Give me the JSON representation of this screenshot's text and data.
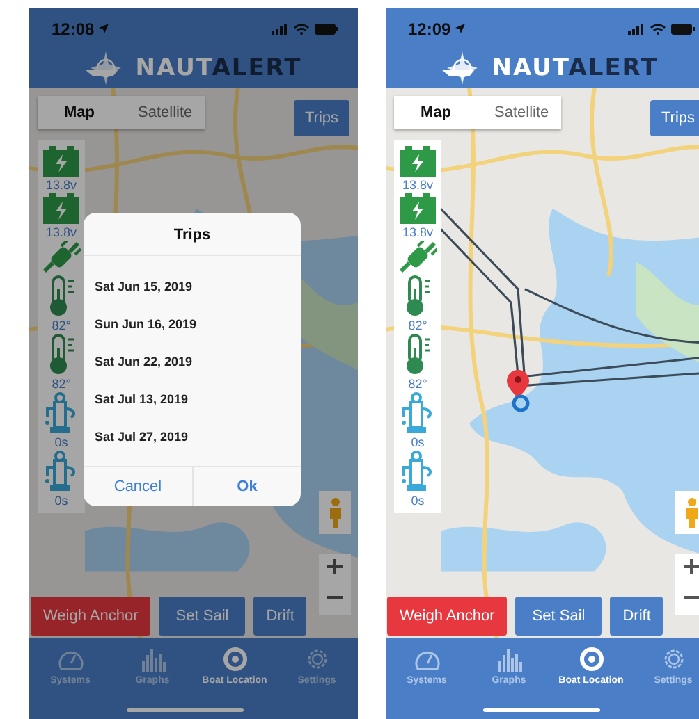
{
  "screens": [
    {
      "status_bar": {
        "time": "12:08"
      },
      "logo": {
        "prefix": "NAUT",
        "suffix": "ALERT"
      },
      "map": {
        "route": false
      },
      "map_types": [
        {
          "label": "Map",
          "selected": true
        },
        {
          "label": "Satellite",
          "selected": false
        }
      ],
      "trips_button": "Trips",
      "sensors": [
        {
          "kind": "battery",
          "reading": "13.8v"
        },
        {
          "kind": "battery",
          "reading": "13.8v"
        },
        {
          "kind": "plug"
        },
        {
          "kind": "thermometer",
          "reading": "82°"
        },
        {
          "kind": "thermometer",
          "reading": "82°"
        },
        {
          "kind": "pump",
          "reading": "0s"
        },
        {
          "kind": "pump",
          "reading": "0s"
        }
      ],
      "dialog": {
        "title": "Trips",
        "items": [
          "Sat Jun 15, 2019",
          "Sun Jun 16, 2019",
          "Sat Jun 22, 2019",
          "Sat Jul 13, 2019",
          "Sat Jul 27, 2019"
        ],
        "buttons": [
          "Cancel",
          "Ok"
        ]
      },
      "actions": [
        {
          "label": "Weigh Anchor",
          "kind": "danger"
        },
        {
          "label": "Set Sail",
          "kind": "primary"
        },
        {
          "label": "Drift",
          "kind": "primary"
        }
      ],
      "tabs": [
        {
          "label": "Systems",
          "kind": "gauge",
          "selected": false
        },
        {
          "label": "Graphs",
          "kind": "chart",
          "selected": false
        },
        {
          "label": "Boat Location",
          "kind": "location",
          "selected": true
        },
        {
          "label": "Settings",
          "kind": "gear",
          "selected": false
        }
      ]
    },
    {
      "status_bar": {
        "time": "12:09"
      },
      "logo": {
        "prefix": "NAUT",
        "suffix": "ALERT"
      },
      "map": {
        "route": true
      },
      "map_types": [
        {
          "label": "Map",
          "selected": true
        },
        {
          "label": "Satellite",
          "selected": false
        }
      ],
      "trips_button": "Trips",
      "sensors": [
        {
          "kind": "battery",
          "reading": "13.8v"
        },
        {
          "kind": "battery",
          "reading": "13.8v"
        },
        {
          "kind": "plug"
        },
        {
          "kind": "thermometer",
          "reading": "82°"
        },
        {
          "kind": "thermometer",
          "reading": "82°"
        },
        {
          "kind": "pump",
          "reading": "0s"
        },
        {
          "kind": "pump",
          "reading": "0s"
        }
      ],
      "actions": [
        {
          "label": "Weigh Anchor",
          "kind": "danger"
        },
        {
          "label": "Set Sail",
          "kind": "primary"
        },
        {
          "label": "Drift",
          "kind": "primary"
        }
      ],
      "tabs": [
        {
          "label": "Systems",
          "kind": "gauge",
          "selected": false
        },
        {
          "label": "Graphs",
          "kind": "chart",
          "selected": false
        },
        {
          "label": "Boat Location",
          "kind": "location",
          "selected": true
        },
        {
          "label": "Settings",
          "kind": "gear",
          "selected": false
        }
      ]
    }
  ]
}
